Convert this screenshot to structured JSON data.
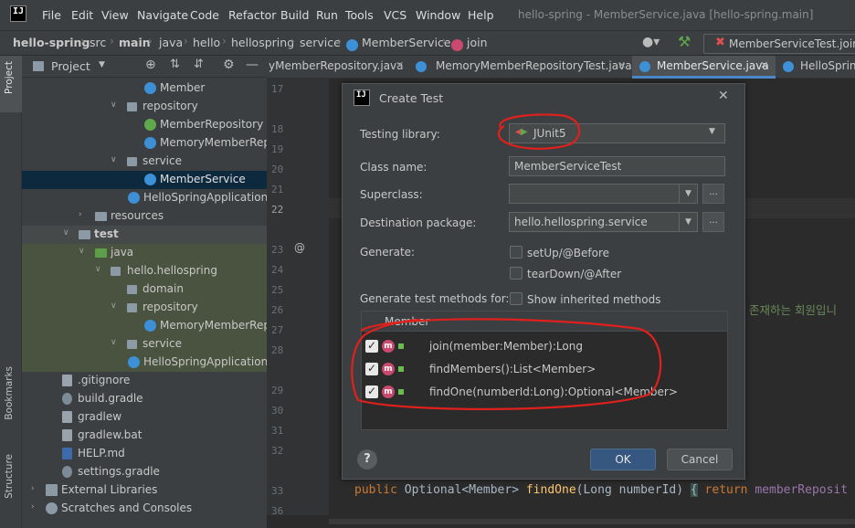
{
  "menubar": {
    "items": [
      "File",
      "Edit",
      "View",
      "Navigate",
      "Code",
      "Refactor",
      "Build",
      "Run",
      "Tools",
      "VCS",
      "Window",
      "Help"
    ],
    "title": "hello-spring - MemberService.java [hello-spring.main]",
    "logo": "IJ"
  },
  "navbar": {
    "crumbs": [
      "hello-spring",
      "src",
      "main",
      "java",
      "hello",
      "hellospring",
      "service",
      "MemberService",
      "join"
    ],
    "run_config": "MemberServiceTest.join"
  },
  "leftstrip": {
    "tabs": [
      "Project",
      "Bookmarks",
      "Structure"
    ]
  },
  "project_panel": {
    "header": "Project",
    "tree": [
      {
        "label": "Member",
        "icon": "class-icon",
        "depth": 0
      },
      {
        "label": "repository",
        "icon": "package-icon",
        "depth": 0
      },
      {
        "label": "MemberRepository",
        "icon": "interface-icon",
        "depth": 0
      },
      {
        "label": "MemoryMemberRepo",
        "icon": "class-icon",
        "depth": 0
      },
      {
        "label": "service",
        "icon": "package-icon",
        "depth": 0
      },
      {
        "label": "MemberService",
        "icon": "class-icon",
        "depth": 0
      },
      {
        "label": "HelloSpringApplication",
        "icon": "class-icon",
        "depth": 0
      },
      {
        "label": "resources",
        "icon": "folder-icon",
        "depth": 0
      },
      {
        "label": "test",
        "icon": "folder-icon",
        "depth": 0
      },
      {
        "label": "java",
        "icon": "folder-icon",
        "depth": 0
      },
      {
        "label": "hello.hellospring",
        "icon": "package-icon",
        "depth": 0
      },
      {
        "label": "domain",
        "icon": "package-icon",
        "depth": 0
      },
      {
        "label": "repository",
        "icon": "package-icon",
        "depth": 0
      },
      {
        "label": "MemoryMemberRepo",
        "icon": "class-icon",
        "depth": 0
      },
      {
        "label": "service",
        "icon": "package-icon",
        "depth": 0
      },
      {
        "label": "HelloSpringApplicationTe",
        "icon": "class-icon",
        "depth": 0
      },
      {
        "label": ".gitignore",
        "icon": "file-icon",
        "depth": 0
      },
      {
        "label": "build.gradle",
        "icon": "gradle-icon",
        "depth": 0
      },
      {
        "label": "gradlew",
        "icon": "file-icon",
        "depth": 0
      },
      {
        "label": "gradlew.bat",
        "icon": "file-icon",
        "depth": 0
      },
      {
        "label": "HELP.md",
        "icon": "markdown-icon",
        "depth": 0
      },
      {
        "label": "settings.gradle",
        "icon": "gradle-icon",
        "depth": 0
      },
      {
        "label": "External Libraries",
        "icon": "library-icon",
        "depth": 0
      },
      {
        "label": "Scratches and Consoles",
        "icon": "scratch-icon",
        "depth": 0
      }
    ]
  },
  "editor": {
    "tabs": [
      "yMemberRepository.java",
      "MemoryMemberRepositoryTest.java",
      "MemberService.java",
      "HelloSpring"
    ],
    "line_numbers": [
      "17",
      "18",
      "19",
      "20",
      "21",
      "22",
      "23",
      "24",
      "25",
      "26",
      "27",
      "28",
      "29",
      "30",
      "31",
      "32",
      "33",
      "36"
    ],
    "korean_text": "존재하는 회원입니",
    "code_line_33": {
      "kw_public": "public",
      "type": "Optional<Member>",
      "method": "findOne",
      "params": "(Long numberId)",
      "brace": "{",
      "kw_return": "return",
      "tail": "memberReposit"
    }
  },
  "dialog": {
    "title": "Create Test",
    "testing_library_label": "Testing library:",
    "testing_library_value": "JUnit5",
    "class_name_label": "Class name:",
    "class_name_value": "MemberServiceTest",
    "superclass_label": "Superclass:",
    "superclass_value": "",
    "dest_package_label": "Destination package:",
    "dest_package_value": "hello.hellospring.service",
    "browse_label": "...",
    "generate_label": "Generate:",
    "setup_label": "setUp/@Before",
    "teardown_label": "tearDown/@After",
    "gen_methods_label": "Generate test methods for:",
    "show_inherited_label": "Show inherited methods",
    "member_header": "Member",
    "methods": [
      {
        "label": "join(member:Member):Long",
        "checked": true
      },
      {
        "label": "findMembers():List<Member>",
        "checked": true
      },
      {
        "label": "findOne(numberId:Long):Optional<Member>",
        "checked": true
      }
    ],
    "help_label": "?",
    "ok_label": "OK",
    "cancel_label": "Cancel"
  },
  "colors": {
    "accent": "#365880",
    "annotation_red": "#e0201c",
    "ok_button": "#365880"
  }
}
